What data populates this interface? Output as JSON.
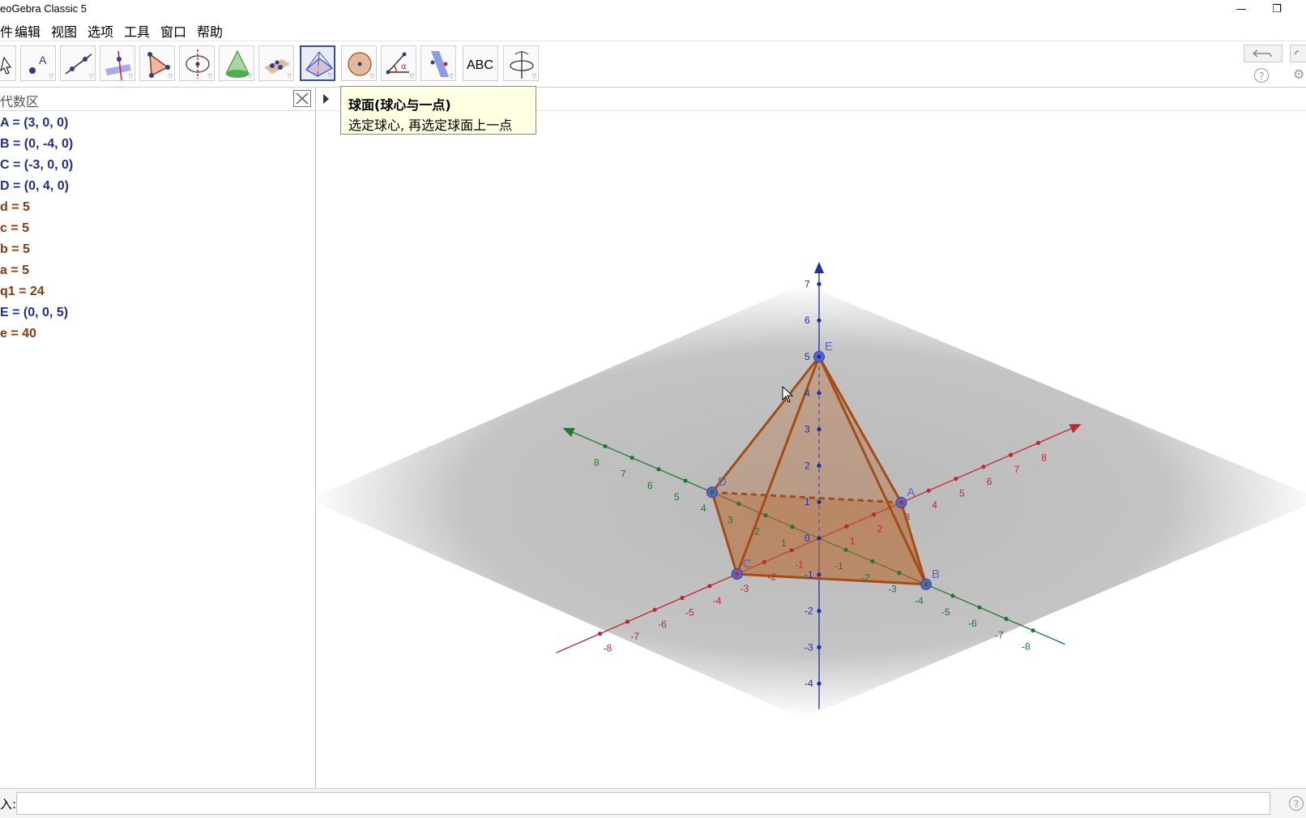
{
  "app": {
    "title": "eoGebra Classic 5"
  },
  "window_controls": {
    "minimize": "—",
    "restore": "❐"
  },
  "menu": [
    "件",
    "编辑",
    "视图",
    "选项",
    "工具",
    "窗口",
    "帮助"
  ],
  "toolbar": {
    "tools": [
      "move",
      "point",
      "line",
      "perpendicular-line",
      "polygon",
      "circle-around-line",
      "pyramid-cone",
      "intersect-surfaces",
      "pyramid-net",
      "sphere",
      "angle",
      "reflect-plane",
      "text",
      "rotate-view"
    ],
    "selected_tool": "pyramid-net",
    "text_tool_label": "ABC"
  },
  "tooltip": {
    "title": "球面(球心与一点)",
    "body": "选定球心, 再选定球面上一点"
  },
  "algebra": {
    "title": "代数区",
    "rows": [
      {
        "text": "A = (3, 0, 0)",
        "color": "#1f2f8c"
      },
      {
        "text": "B = (0, -4, 0)",
        "color": "#1f2f8c"
      },
      {
        "text": "C = (-3, 0, 0)",
        "color": "#1f2f8c"
      },
      {
        "text": "D = (0, 4, 0)",
        "color": "#1f2f8c"
      },
      {
        "text": "d = 5",
        "color": "#8b3a0f"
      },
      {
        "text": "c = 5",
        "color": "#8b3a0f"
      },
      {
        "text": "b = 5",
        "color": "#8b3a0f"
      },
      {
        "text": "a = 5",
        "color": "#8b3a0f"
      },
      {
        "text": "q1 = 24",
        "color": "#8b3a0f"
      },
      {
        "text": "E = (0, 0, 5)",
        "color": "#1f2f8c"
      },
      {
        "text": "e = 40",
        "color": "#8b3a0f"
      }
    ]
  },
  "graphics3d": {
    "x_axis_color": "#c0282e",
    "y_axis_color": "#1e7a2a",
    "z_axis_color": "#1f2fa0",
    "solid_color": "#b8642c",
    "point_color": "#5b63c7",
    "points": [
      "A",
      "B",
      "C",
      "D",
      "E"
    ],
    "x_ticks": [
      "-8",
      "-7",
      "-6",
      "-5",
      "-4",
      "-3",
      "-2",
      "-1",
      "0",
      "1",
      "2",
      "3",
      "4",
      "5",
      "6",
      "7",
      "8"
    ],
    "y_ticks": [
      "-8",
      "-7",
      "-6",
      "-5",
      "-4",
      "-3",
      "-2",
      "-1",
      "0",
      "1",
      "2",
      "3",
      "4",
      "5",
      "6",
      "7",
      "8"
    ],
    "z_ticks": [
      "-4",
      "-3",
      "-2",
      "-1",
      "0",
      "1",
      "2",
      "3",
      "4",
      "5",
      "6",
      "7"
    ]
  },
  "input": {
    "label": "入:",
    "value": ""
  }
}
